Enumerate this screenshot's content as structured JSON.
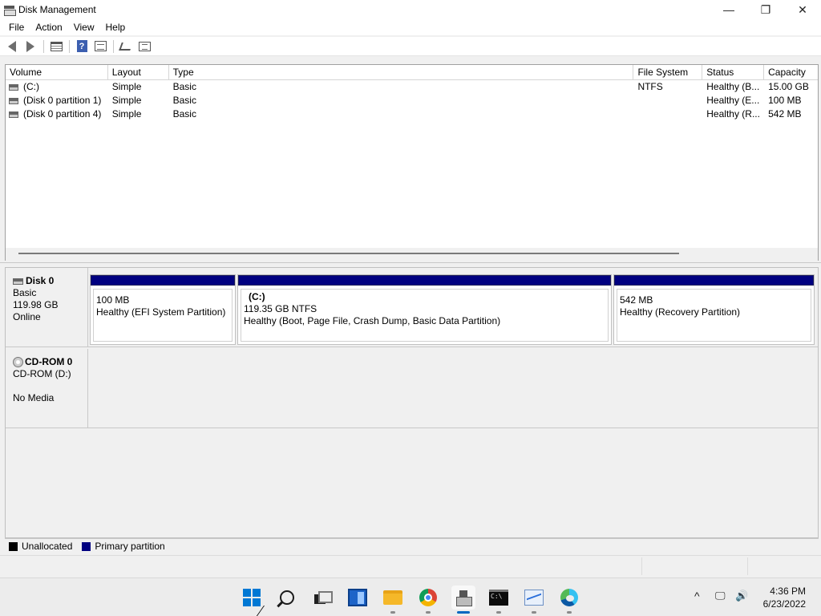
{
  "window": {
    "title": "Disk Management",
    "controls": {
      "minimize": "—",
      "maximize": "❐",
      "close": "✕"
    }
  },
  "menu": [
    "File",
    "Action",
    "View",
    "Help"
  ],
  "toolbar": {
    "icons": [
      "back-icon",
      "forward-icon",
      "list-view-icon",
      "help-icon",
      "properties-icon",
      "connect-icon",
      "check-icon"
    ]
  },
  "volume_list": {
    "columns": [
      "Volume",
      "Layout",
      "Type",
      "File System",
      "Status",
      "Capacity"
    ],
    "rows": [
      {
        "volume": "(C:)",
        "layout": "Simple",
        "type": "Basic",
        "fs": "NTFS",
        "status": "Healthy (B...",
        "capacity": "15.00 GB"
      },
      {
        "volume": "(Disk 0 partition 1)",
        "layout": "Simple",
        "type": "Basic",
        "fs": "",
        "status": "Healthy (E...",
        "capacity": "100 MB"
      },
      {
        "volume": "(Disk 0 partition 4)",
        "layout": "Simple",
        "type": "Basic",
        "fs": "",
        "status": "Healthy (R...",
        "capacity": "542 MB"
      }
    ]
  },
  "disks": [
    {
      "name": "Disk 0",
      "type": "Basic",
      "size": "119.98 GB",
      "state": "Online",
      "partitions": [
        {
          "name": "",
          "line1": "100 MB",
          "line2": "Healthy (EFI System Partition)"
        },
        {
          "name": "(C:)",
          "line1": "119.35 GB NTFS",
          "line2": "Healthy (Boot, Page File, Crash Dump, Basic Data Partition)"
        },
        {
          "name": "",
          "line1": "542 MB",
          "line2": "Healthy (Recovery Partition)"
        }
      ]
    },
    {
      "name": "CD-ROM 0",
      "type": "CD-ROM (D:)",
      "state": "No Media"
    }
  ],
  "legend": [
    {
      "label": "Unallocated",
      "color": "#000000"
    },
    {
      "label": "Primary partition",
      "color": "#000080"
    }
  ],
  "taskbar": {
    "apps": [
      "start-icon",
      "search-icon",
      "task-view-icon",
      "widgets-icon",
      "file-explorer-icon",
      "chrome-icon",
      "disk-management-icon",
      "command-prompt-icon",
      "performance-monitor-icon",
      "edge-icon"
    ],
    "tray": {
      "chevron": "^",
      "network": "🖵",
      "volume": "🔊"
    },
    "time": "4:36 PM",
    "date": "6/23/2022"
  }
}
